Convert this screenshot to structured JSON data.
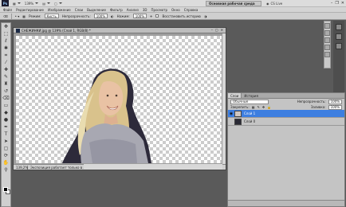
{
  "appbar": {
    "logo": "Ps",
    "zoom": "139%",
    "workspace": "Основная рабочая среда",
    "cslive": "CS Live"
  },
  "menu": [
    "Файл",
    "Редактирование",
    "Изображение",
    "Слои",
    "Выделение",
    "Фильтр",
    "Анализ",
    "3D",
    "Просмотр",
    "Окно",
    "Справка"
  ],
  "options": {
    "mode_label": "Режим:",
    "mode_value": "Кисть",
    "opacity_label": "Непрозрачность:",
    "opacity_value": "100%",
    "pressure_label": "Нажим:",
    "pressure_value": "100%",
    "history_label": "Восстановить историю"
  },
  "document": {
    "title": "СНЕЖИНКИ.jpg @ 139% (Слой 1, RGB/8) *",
    "zoom": "139,2%",
    "status": "Экспозиция работает только в ..."
  },
  "layers_panel": {
    "tabs": [
      "Слои",
      "История"
    ],
    "blend_mode": "Обычные",
    "opacity_label": "Непрозрачность:",
    "opacity_value": "100%",
    "lock_label": "Закрепить:",
    "fill_label": "Заливка:",
    "fill_value": "100%",
    "layers": [
      {
        "name": "Слой 1",
        "selected": true
      },
      {
        "name": "Слой 0",
        "selected": false
      }
    ]
  },
  "colors": {
    "selection": "#3d7ee0",
    "foreground": "#000000",
    "background": "#ffffff"
  }
}
